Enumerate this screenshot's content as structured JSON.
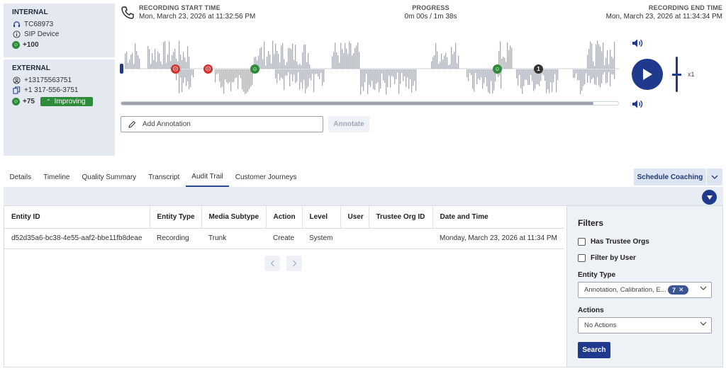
{
  "internal": {
    "title": "INTERNAL",
    "agent_id": "TC68973",
    "device": "SIP Device",
    "score": "+100"
  },
  "external": {
    "title": "EXTERNAL",
    "phone_1": "+13175563751",
    "phone_2": "+1 317-556-3751",
    "score": "+75",
    "trend": "Improving"
  },
  "recording": {
    "start_label": "RECORDING START TIME",
    "start_value": "Mon, March 23, 2026 at 11:32:56 PM",
    "progress_label": "PROGRESS",
    "progress_value": "0m 00s / 1m 38s",
    "end_label": "RECORDING END TIME",
    "end_value": "Mon, March 23, 2026 at 11:34:34 PM",
    "playback_speed": "x1",
    "scrubber_fill_fraction": 0.95,
    "volume_level_fraction": 0.5,
    "marker_badge": "1"
  },
  "annotation": {
    "placeholder": "Add Annotation",
    "button": "Annotate"
  },
  "tabs": [
    "Details",
    "Timeline",
    "Quality Summary",
    "Transcript",
    "Audit Trail",
    "Customer Journeys"
  ],
  "active_tab": "Audit Trail",
  "schedule_button": "Schedule Coaching",
  "table": {
    "headers": [
      "Entity ID",
      "Entity Type",
      "Media Subtype",
      "Action",
      "Level",
      "User",
      "Trustee Org ID",
      "Date and Time"
    ],
    "rows": [
      [
        "d52d35a6-bc38-4e55-aaf2-bbe11fb8deae",
        "Recording",
        "Trunk",
        "Create",
        "System",
        "",
        "",
        "Monday, March 23, 2026 at 11:34 PM"
      ]
    ]
  },
  "filters": {
    "title": "Filters",
    "has_trustee_orgs": "Has Trustee Orgs",
    "filter_by_user": "Filter by User",
    "entity_type_label": "Entity Type",
    "entity_type_value": "Annotation, Calibration, E...",
    "entity_type_count": "7",
    "actions_label": "Actions",
    "actions_value": "No Actions",
    "search_button": "Search"
  },
  "colors": {
    "primary": "#1f3a8c",
    "positive": "#2e8b3a",
    "negative": "#d32f2f",
    "panel": "#e4e9f1"
  }
}
